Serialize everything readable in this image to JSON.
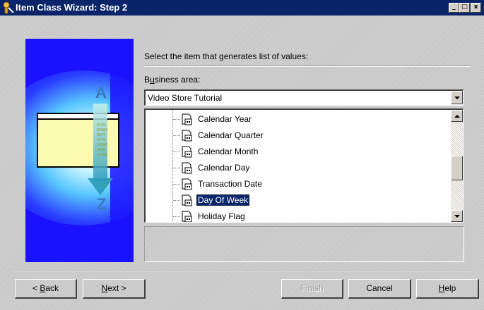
{
  "window": {
    "title": "Item Class Wizard: Step 2",
    "minimize_glyph": "_",
    "maximize_glyph": "□",
    "close_glyph": "x"
  },
  "art": {
    "letter_top": "A",
    "letter_bottom": "Z",
    "code_lines": [
      "6749",
      "95584",
      "9847",
      "4278",
      "24280",
      "9458",
      "3e586"
    ]
  },
  "instruction": "Select the item that generates list of values:",
  "business_area": {
    "label_pre": "B",
    "label_mnemonic": "u",
    "label_post": "siness area:",
    "value": "Video Store Tutorial"
  },
  "tree": {
    "items": [
      {
        "label": "Calendar Year",
        "selected": false
      },
      {
        "label": "Calendar Quarter",
        "selected": false
      },
      {
        "label": "Calendar Month",
        "selected": false
      },
      {
        "label": "Calendar Day",
        "selected": false
      },
      {
        "label": "Transaction Date",
        "selected": false
      },
      {
        "label": "Day Of Week",
        "selected": true
      },
      {
        "label": "Holiday Flag",
        "selected": false
      }
    ]
  },
  "buttons": {
    "back": {
      "mnemonic": "B",
      "rest": "ack",
      "prefix": "< "
    },
    "next": {
      "mnemonic": "N",
      "rest": "ext",
      "suffix": " >"
    },
    "finish": "Finish",
    "cancel": "Cancel",
    "help": {
      "mnemonic": "H",
      "rest": "elp"
    }
  },
  "colors": {
    "titlebar": "#0a246a",
    "selection": "#0a246a",
    "art_blue": "#1a12ff"
  }
}
